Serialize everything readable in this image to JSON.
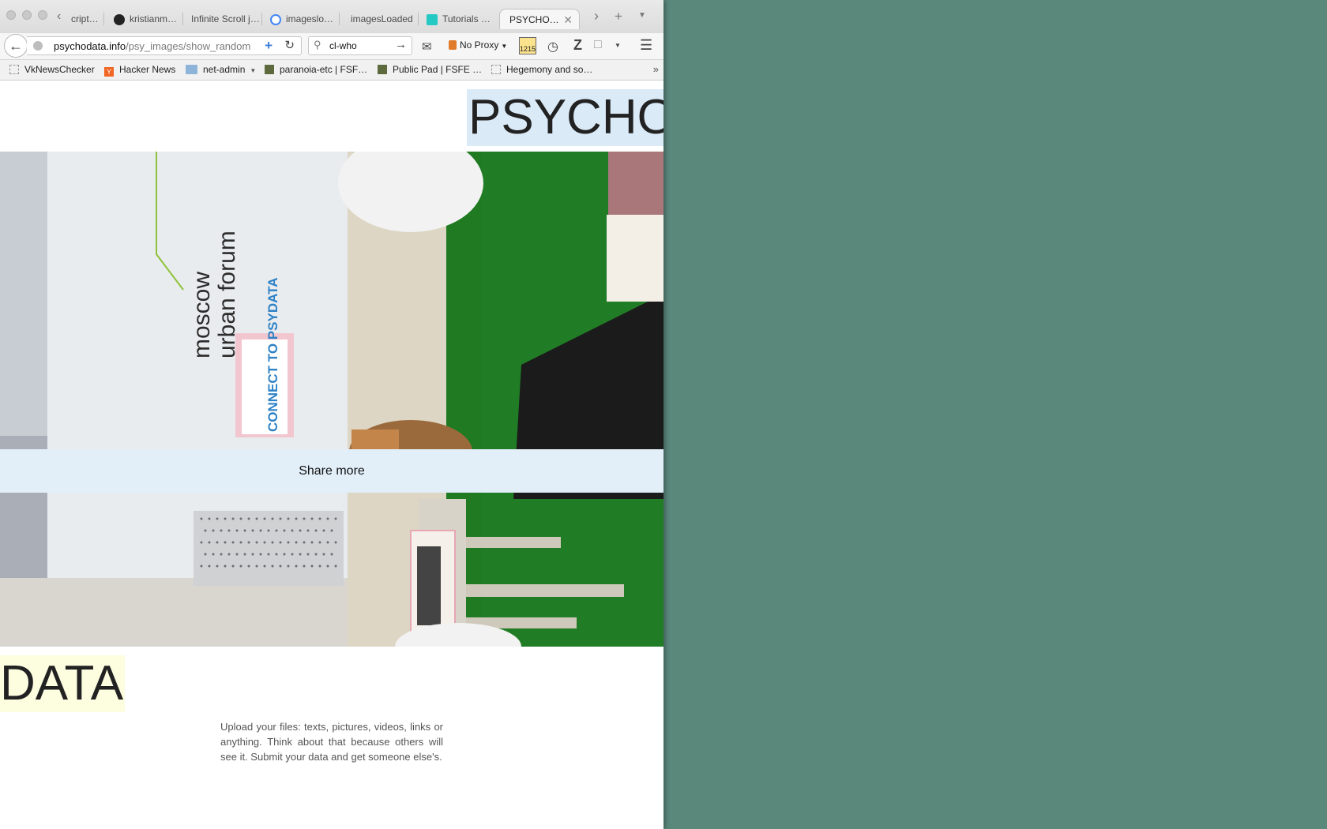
{
  "browser": {
    "tabs": [
      {
        "label": "cript…"
      },
      {
        "label": "kristianm…"
      },
      {
        "label": "Infinite Scroll j…"
      },
      {
        "label": "imageslo…"
      },
      {
        "label": "imagesLoaded"
      },
      {
        "label": "Tutorials …"
      },
      {
        "label": "PSYCHO…",
        "active": true
      }
    ],
    "url_host": "psychodata.info",
    "url_path": "/psy_images/show_random",
    "search_value": "cl-who",
    "proxy_label": "No Proxy",
    "counter_badge": "1215",
    "bookmarks": [
      {
        "label": "VkNewsChecker"
      },
      {
        "label": "Hacker News"
      },
      {
        "label": "net-admin"
      },
      {
        "label": "paranoia-etc | FSF…"
      },
      {
        "label": "Public Pad | FSFE …"
      },
      {
        "label": "Hegemony and so…"
      }
    ]
  },
  "page": {
    "title_top": "PSYCHO",
    "title_bottom": "DATA",
    "share_label": "Share more",
    "description": "Upload your files: texts, pictures, videos, links or anything. Think about that because others will see it. Submit your data and get someone else's.",
    "photo": {
      "sign_line1": "moscow",
      "sign_line2": "urban forum",
      "poster_text": "CONNECT TO PSYDATA"
    }
  },
  "colors": {
    "desktop": "#5a887b",
    "psycho_highlight": "#dbeaf7",
    "data_highlight": "#fdfde0",
    "share_bar": "#e2eff9",
    "carpet": "#1f7a22"
  }
}
